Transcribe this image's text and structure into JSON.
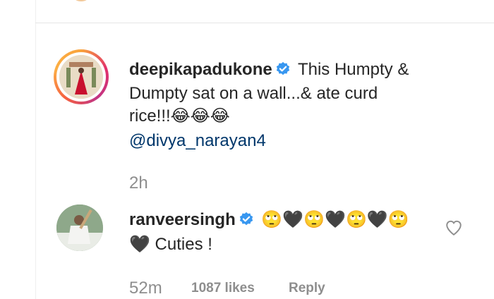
{
  "post_comment": {
    "username": "deepikapadukone",
    "text_line1": "This Humpty &",
    "text_line2": "Dumpty sat on a wall...& ate curd",
    "text_line3": "rice!!!😂😂😂",
    "mention": "@divya_narayan4",
    "time": "2h"
  },
  "reply_comment": {
    "username": "ranveersingh",
    "emoji_line": "🙄🖤🙄🖤🙄🖤🙄",
    "text": "🖤 Cuties !",
    "time": "52m",
    "likes": "1087 likes",
    "reply_label": "Reply"
  },
  "colors": {
    "verified": "#3897f0",
    "mention": "#00376b",
    "meta": "#8e8e8e"
  }
}
